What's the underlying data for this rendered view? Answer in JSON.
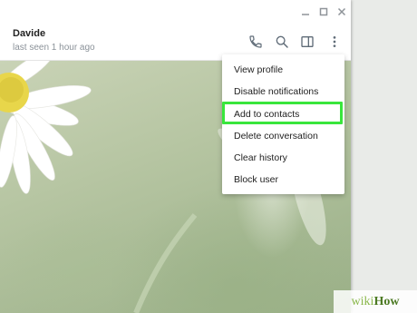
{
  "chat": {
    "name": "Davide",
    "status": "last seen 1 hour ago"
  },
  "header_icons": [
    "phone-icon",
    "search-icon",
    "sidebar-toggle-icon",
    "more-vertical-icon"
  ],
  "window_controls": [
    "minimize-icon",
    "maximize-icon",
    "close-icon"
  ],
  "menu": {
    "items": [
      {
        "label": "View profile"
      },
      {
        "label": "Disable notifications"
      },
      {
        "label": "Add to contacts",
        "highlighted": true
      },
      {
        "label": "Delete conversation"
      },
      {
        "label": "Clear history"
      },
      {
        "label": "Block user"
      }
    ]
  },
  "watermark": {
    "part1": "wiki",
    "part2": "How"
  },
  "colors": {
    "highlight": "#39e63c",
    "icon": "#5f6b77",
    "status_text": "#8b9299"
  }
}
